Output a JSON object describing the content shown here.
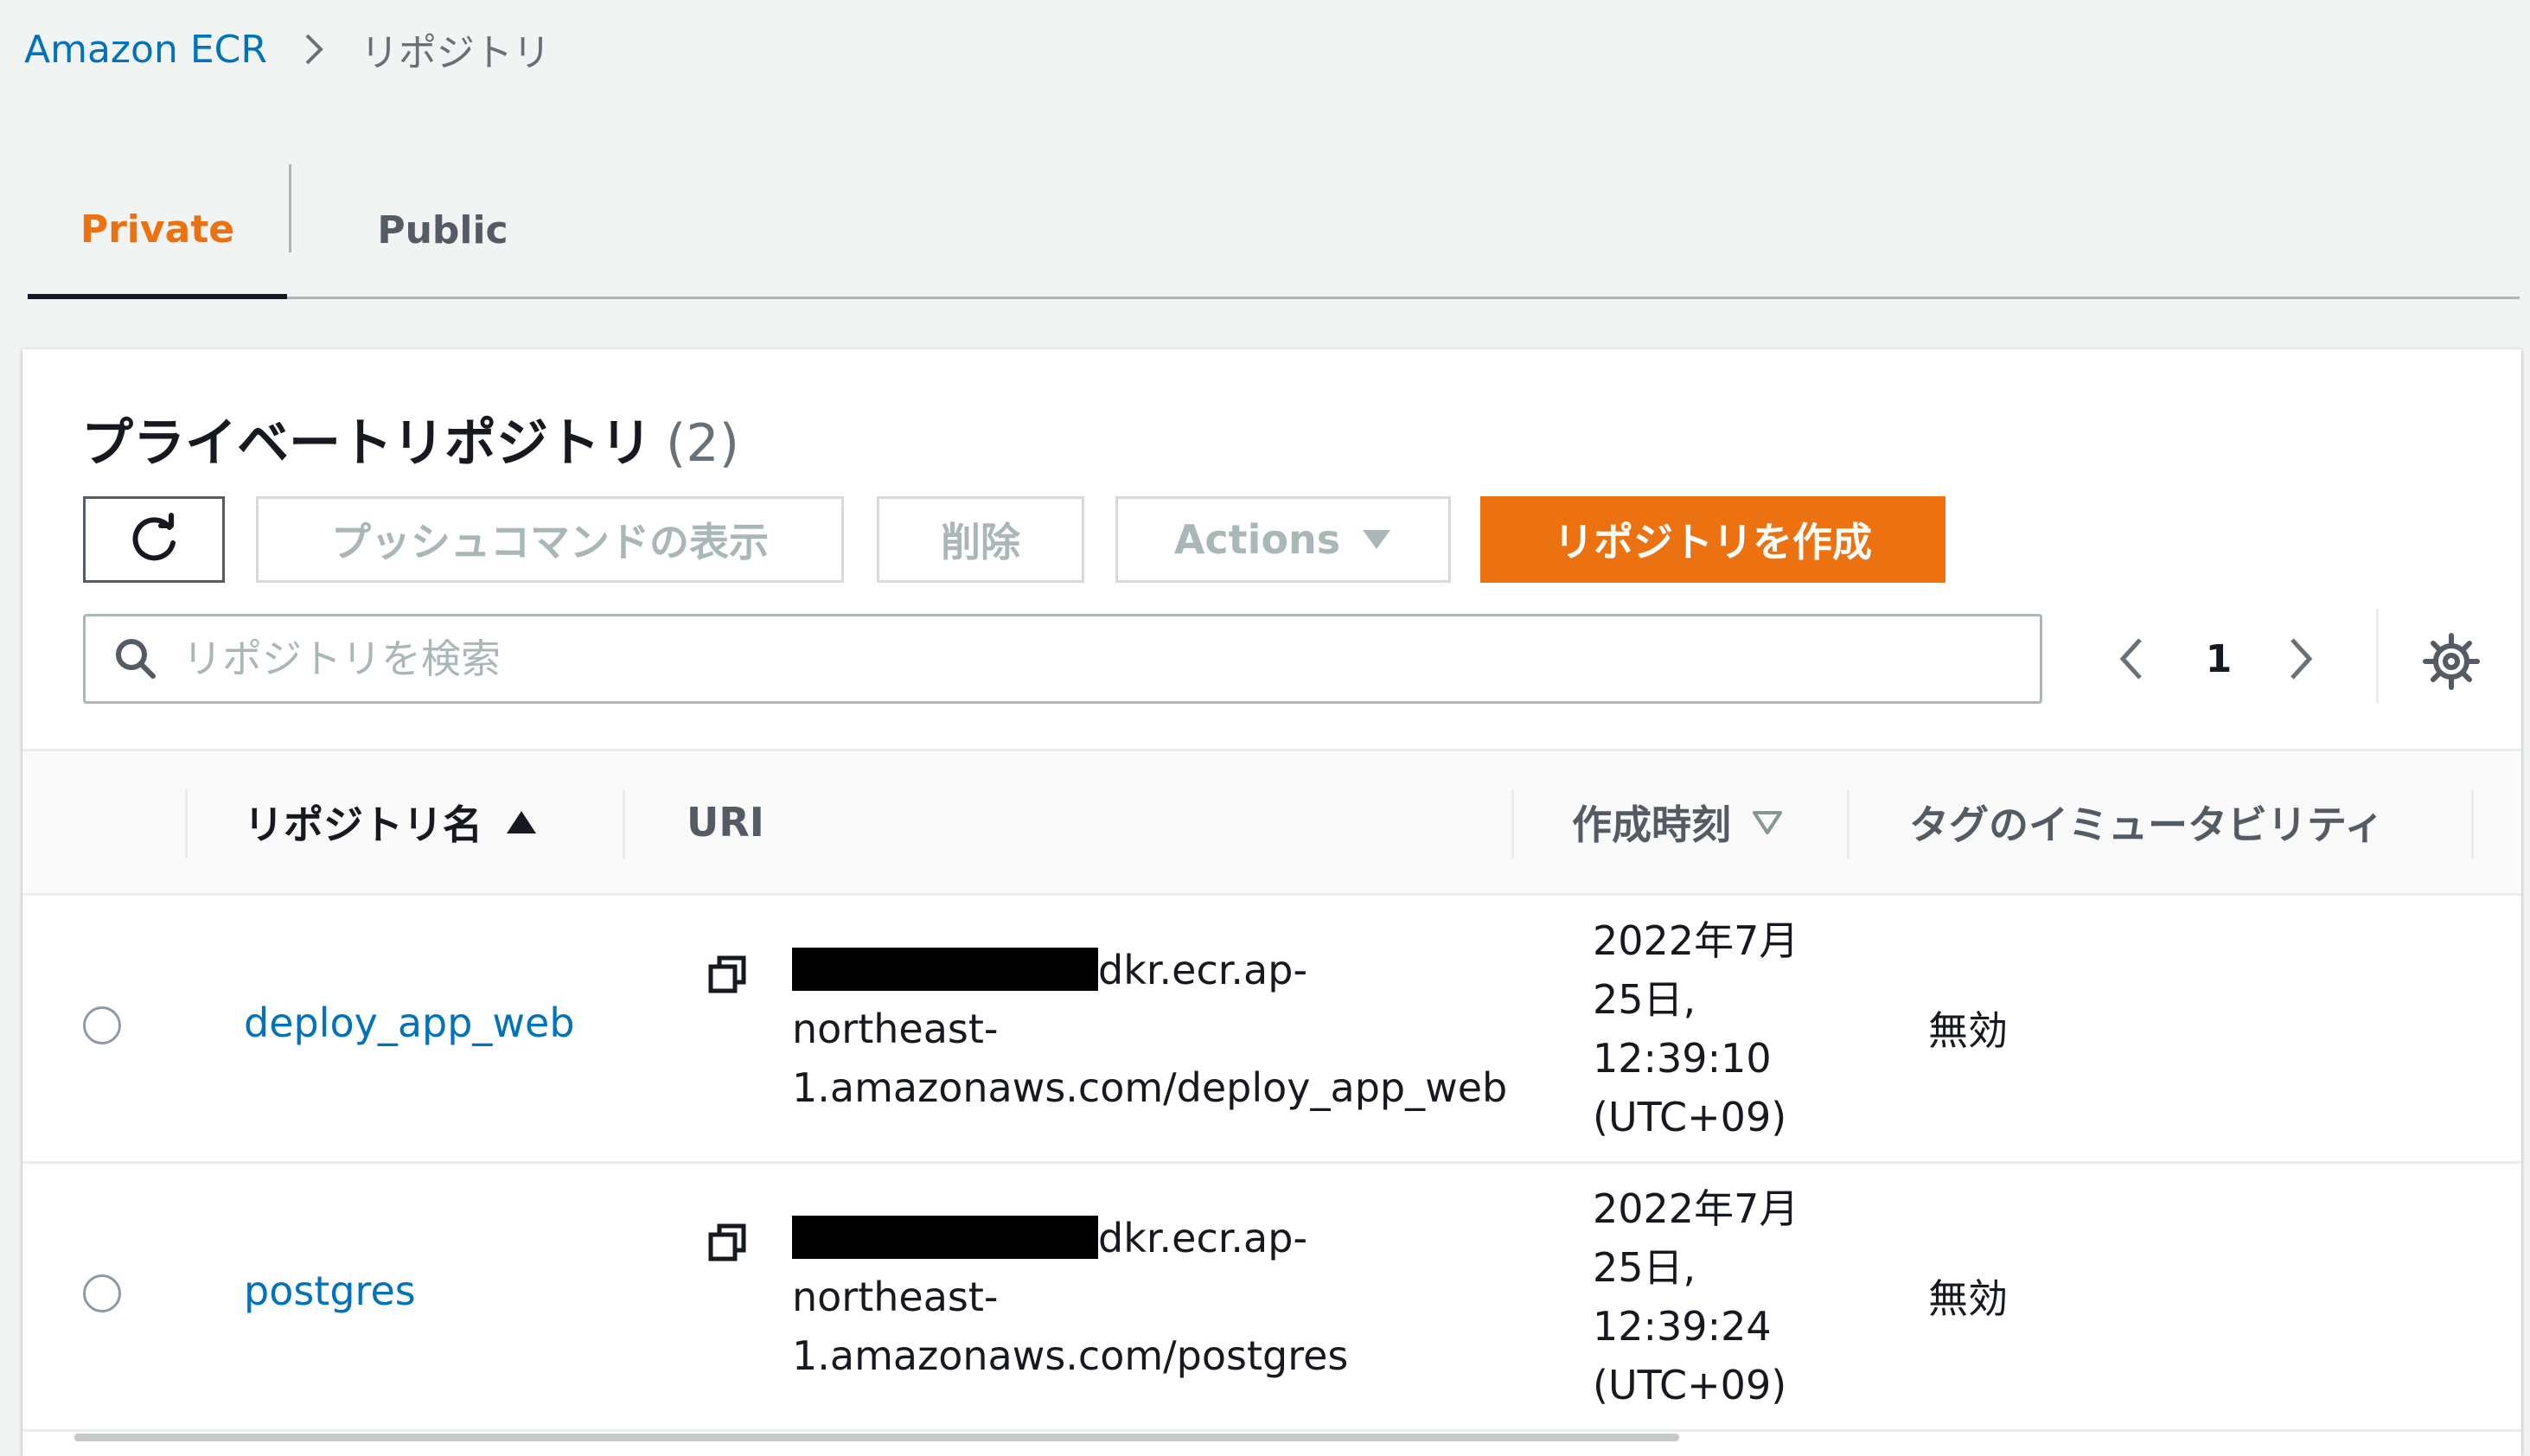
{
  "breadcrumb": {
    "root": "Amazon ECR",
    "current": "リポジトリ"
  },
  "tabs": {
    "private": "Private",
    "public": "Public",
    "selected": "Private"
  },
  "panel": {
    "title": "プライベートリポジトリ",
    "count": "(2)"
  },
  "toolbar": {
    "push_commands": "プッシュコマンドの表示",
    "delete": "削除",
    "actions": "Actions",
    "create": "リポジトリを作成"
  },
  "search": {
    "placeholder": "リポジトリを検索",
    "value": ""
  },
  "pagination": {
    "current_page": "1"
  },
  "table": {
    "headers": {
      "name": "リポジトリ名",
      "uri": "URI",
      "created": "作成時刻",
      "tag_immutability": "タグのイミュータビリティ"
    },
    "rows": [
      {
        "name": "deploy_app_web",
        "uri_suffix": "dkr.ecr.ap-",
        "uri_line2": "northeast-",
        "uri_line3": "1.amazonaws.com/deploy_app_web",
        "created_line1": "2022年7月",
        "created_line2": "25日,",
        "created_line3": "12:39:10",
        "created_line4": "(UTC+09)",
        "tag_immutability": "無効"
      },
      {
        "name": "postgres",
        "uri_suffix": "dkr.ecr.ap-",
        "uri_line2": "northeast-",
        "uri_line3": "1.amazonaws.com/postgres",
        "created_line1": "2022年7月",
        "created_line2": "25日,",
        "created_line3": "12:39:24",
        "created_line4": "(UTC+09)",
        "tag_immutability": "無効"
      }
    ]
  },
  "colors": {
    "accent_orange": "#ec7211",
    "link_blue": "#0073bb",
    "background": "#f2f3f3"
  },
  "icons": [
    "chevron-right-icon",
    "refresh-icon",
    "caret-down-icon",
    "search-icon",
    "chevron-left-icon",
    "gear-icon",
    "sort-ascending-icon",
    "sort-descending-icon",
    "copy-icon"
  ]
}
